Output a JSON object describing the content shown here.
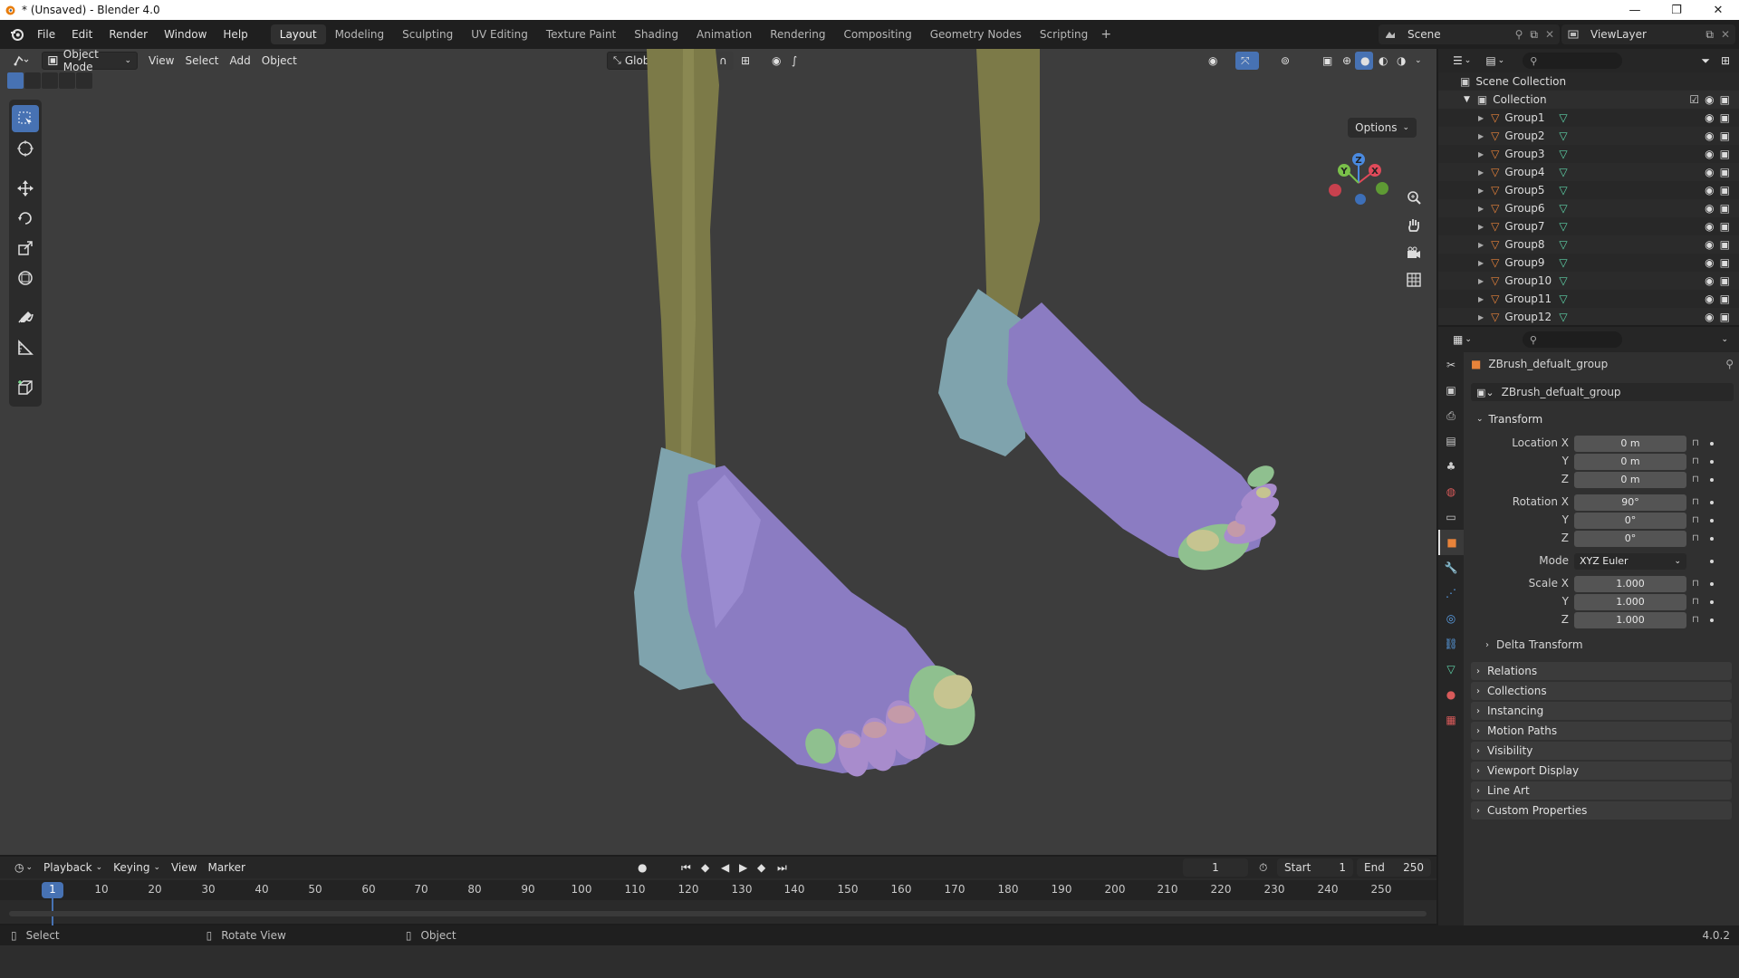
{
  "window": {
    "title": "* (Unsaved) - Blender 4.0",
    "controls": [
      "—",
      "❐",
      "✕"
    ]
  },
  "menubar": {
    "items": [
      "File",
      "Edit",
      "Render",
      "Window",
      "Help"
    ]
  },
  "workspaces": {
    "tabs": [
      "Layout",
      "Modeling",
      "Sculpting",
      "UV Editing",
      "Texture Paint",
      "Shading",
      "Animation",
      "Rendering",
      "Compositing",
      "Geometry Nodes",
      "Scripting"
    ],
    "active": "Layout",
    "add_label": "+"
  },
  "scene": {
    "name": "Scene",
    "view_layer": "ViewLayer"
  },
  "viewport_header": {
    "mode": "Object Mode",
    "menus": [
      "View",
      "Select",
      "Add",
      "Object"
    ],
    "orientation": "Global",
    "options_label": "Options"
  },
  "gizmo": {
    "x": "X",
    "y": "Y",
    "z": "Z"
  },
  "outliner": {
    "root": "Scene Collection",
    "collection": "Collection",
    "items": [
      "Group1",
      "Group2",
      "Group3",
      "Group4",
      "Group5",
      "Group6",
      "Group7",
      "Group8",
      "Group9",
      "Group10",
      "Group11",
      "Group12"
    ]
  },
  "properties": {
    "object_name": "ZBrush_defualt_group",
    "object_field": "ZBrush_defualt_group",
    "transform_title": "Transform",
    "location": {
      "label_x": "Location X",
      "label_y": "Y",
      "label_z": "Z",
      "x": "0 m",
      "y": "0 m",
      "z": "0 m"
    },
    "rotation": {
      "label_x": "Rotation X",
      "label_y": "Y",
      "label_z": "Z",
      "x": "90°",
      "y": "0°",
      "z": "0°"
    },
    "mode": {
      "label": "Mode",
      "value": "XYZ Euler"
    },
    "scale": {
      "label_x": "Scale X",
      "label_y": "Y",
      "label_z": "Z",
      "x": "1.000",
      "y": "1.000",
      "z": "1.000"
    },
    "delta_transform": "Delta Transform",
    "panels": [
      "Relations",
      "Collections",
      "Instancing",
      "Motion Paths",
      "Visibility",
      "Viewport Display",
      "Line Art",
      "Custom Properties"
    ]
  },
  "timeline": {
    "menus": [
      "Playback",
      "Keying",
      "View",
      "Marker"
    ],
    "current_frame": "1",
    "start_label": "Start",
    "start": "1",
    "end_label": "End",
    "end": "250",
    "ticks": [
      "1",
      "10",
      "20",
      "30",
      "40",
      "50",
      "60",
      "70",
      "80",
      "90",
      "100",
      "110",
      "120",
      "130",
      "140",
      "150",
      "160",
      "170",
      "180",
      "190",
      "200",
      "210",
      "220",
      "230",
      "240",
      "250"
    ]
  },
  "statusbar": {
    "select": "Select",
    "rotate": "Rotate View",
    "object": "Object",
    "version": "4.0.2"
  },
  "colors": {
    "accent": "#4772b3",
    "leg": "#7a7a48",
    "foot": "#8a7bc0",
    "heel": "#7fa6b0",
    "toe_green": "#8fc08f",
    "toe_pink": "#c49aa8",
    "toe_yellow": "#c6c490",
    "object_orange": "#e8833a",
    "mesh_green": "#5ed3a8"
  }
}
